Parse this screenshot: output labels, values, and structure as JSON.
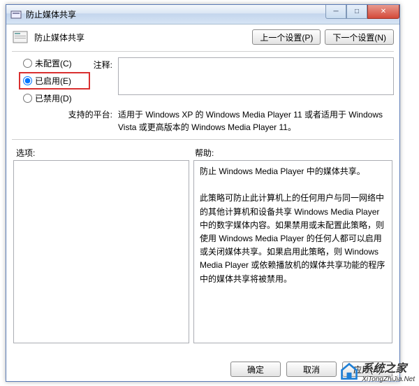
{
  "titlebar": {
    "title": "防止媒体共享"
  },
  "header": {
    "title": "防止媒体共享",
    "prev_btn": "上一个设置(P)",
    "next_btn": "下一个设置(N)"
  },
  "radios": {
    "not_configured": "未配置(C)",
    "enabled": "已启用(E)",
    "disabled": "已禁用(D)"
  },
  "labels": {
    "comment": "注释:",
    "platform": "支持的平台:",
    "options": "选项:",
    "help": "帮助:"
  },
  "platform_text": "适用于 Windows XP 的 Windows Media Player 11 或者适用于 Windows Vista 或更高版本的 Windows Media Player 11。",
  "help_text": "防止 Windows Media Player 中的媒体共享。\n\n此策略可防止此计算机上的任何用户与同一网络中的其他计算机和设备共享 Windows Media Player 中的数字媒体内容。如果禁用或未配置此策略，则使用 Windows Media Player 的任何人都可以启用或关闭媒体共享。如果启用此策略，则 Windows Media Player 或依赖播放机的媒体共享功能的程序中的媒体共享将被禁用。",
  "footer": {
    "ok": "确定",
    "cancel": "取消",
    "apply": "应用(A)"
  },
  "watermark": {
    "brand": "系统之家",
    "url": "XiTongZhiJia.Net"
  }
}
